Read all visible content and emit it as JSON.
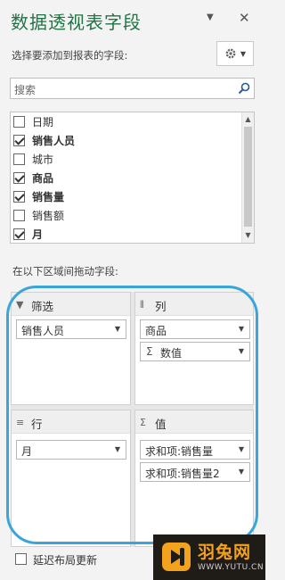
{
  "panel": {
    "title": "数据透视表字段",
    "choose_label": "选择要添加到报表的字段:",
    "search_placeholder": "搜索"
  },
  "fields": [
    {
      "label": "日期",
      "checked": false
    },
    {
      "label": "销售人员",
      "checked": true
    },
    {
      "label": "城市",
      "checked": false
    },
    {
      "label": "商品",
      "checked": true
    },
    {
      "label": "销售量",
      "checked": true
    },
    {
      "label": "销售额",
      "checked": false
    },
    {
      "label": "月",
      "checked": true
    }
  ],
  "drag_label": "在以下区域间拖动字段:",
  "areas": {
    "filter": {
      "title": "筛选",
      "items": [
        "销售人员"
      ]
    },
    "columns": {
      "title": "列",
      "items": [
        "商品",
        "数值"
      ]
    },
    "rows": {
      "title": "行",
      "items": [
        "月"
      ]
    },
    "values": {
      "title": "值",
      "items": [
        "求和项:销售量",
        "求和项:销售量2"
      ]
    }
  },
  "footer": {
    "defer_label": "延迟布局更新",
    "defer_checked": false
  },
  "watermark": {
    "name": "羽兔网",
    "url": "WWW.YUTU.CN"
  },
  "colors": {
    "title": "#217346",
    "highlight_oval": "#3ba4d8",
    "watermark_bg": "#1f1b17",
    "watermark_accent": "#f4a11d"
  }
}
